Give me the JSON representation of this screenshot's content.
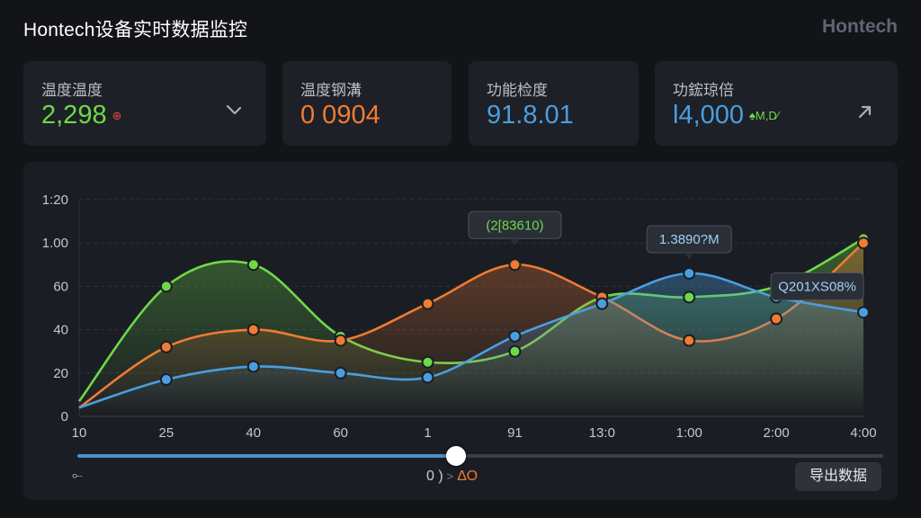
{
  "app": {
    "title": "Hontech设备实时数据监控",
    "brand": "Hontech"
  },
  "colors": {
    "green": "#6fd84a",
    "orange": "#f07b33",
    "blue": "#4a9ee0",
    "bg": "#121418",
    "panel": "#1d2026"
  },
  "cards": [
    {
      "label": "温度温度",
      "value": "2,298",
      "badge": "⊕",
      "value_color": "#6fd84a",
      "badge_color": "#e0473e",
      "icon": "chevron-down-right-icon"
    },
    {
      "label": "温度钢溝",
      "value": "0 0904",
      "value_color": "#f07b33"
    },
    {
      "label": "功能检度",
      "value": "91.8.01",
      "value_color": "#4a9ee0"
    },
    {
      "label": "功鋐琼倍",
      "value": "l4,000",
      "badge": "♠M,D⁄",
      "value_color": "#4a9ee0",
      "badge_color": "#6fd84a",
      "icon": "arrow-up-right-icon"
    }
  ],
  "chart_data": {
    "type": "line",
    "y_tick_labels": [
      "1:20",
      "1.00",
      "60",
      "40",
      "20",
      "0"
    ],
    "x_tick_labels": [
      "10",
      "25",
      "40",
      "60",
      "1",
      "91",
      "13:0",
      "1:00",
      "2:00",
      "4:00"
    ],
    "x": [
      0,
      1,
      2,
      3,
      4,
      5,
      6,
      7,
      8,
      9
    ],
    "ylim": [
      0,
      100
    ],
    "grid": true,
    "series": [
      {
        "color": "#6fd84a",
        "values": [
          7,
          60,
          70,
          37,
          25,
          30,
          55,
          55,
          60,
          82
        ],
        "area": true
      },
      {
        "color": "#f07b33",
        "values": [
          4,
          32,
          40,
          35,
          52,
          70,
          55,
          35,
          45,
          80
        ],
        "area": true
      },
      {
        "color": "#4a9ee0",
        "values": [
          4,
          17,
          23,
          20,
          18,
          37,
          52,
          66,
          55,
          48
        ],
        "area": true
      }
    ],
    "annotations": [
      {
        "text": "(2[83610)",
        "color": "#6fd84a"
      },
      {
        "text": "1.3890?M",
        "color": "#9fd0f5"
      },
      {
        "text": "Q201XS08%",
        "color": "#9fd0f5"
      }
    ]
  },
  "slider": {
    "position": 0.47
  },
  "bottom": {
    "left_symbol": "⟜",
    "mid_text": "0 )",
    "arrow": ">",
    "accent_text": "ΔΟ"
  },
  "export_button": {
    "label": "导出数据"
  }
}
